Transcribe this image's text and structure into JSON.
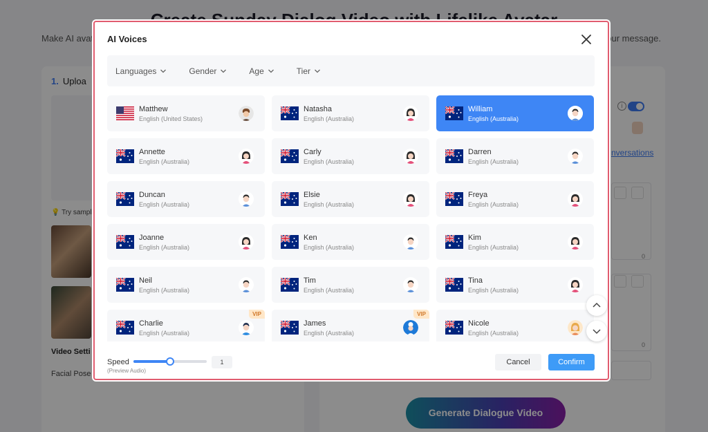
{
  "background": {
    "title": "Create Sunday Dialog Video with Lifelike Avatar",
    "subtitle": "Make AI avat",
    "subtitle_right": "our message.",
    "upload_num": "1.",
    "upload_label": "Uploa",
    "try_sample": "Try sample",
    "video_settings": "Video Setti",
    "facial_pose": "Facial Pose",
    "link": "nversations",
    "info": "i",
    "zero_1": "0",
    "zero_2": "0",
    "generate_button": "Generate Dialogue Video"
  },
  "modal": {
    "title": "AI Voices",
    "filters": [
      {
        "label": "Languages"
      },
      {
        "label": "Gender"
      },
      {
        "label": "Age"
      },
      {
        "label": "Tier"
      }
    ],
    "voices": [
      {
        "name": "Matthew",
        "lang": "English (United States)",
        "flag": "us",
        "avatar": "male-curly",
        "vip": false,
        "selected": false
      },
      {
        "name": "Natasha",
        "lang": "English (Australia)",
        "flag": "au",
        "avatar": "female",
        "vip": false,
        "selected": false
      },
      {
        "name": "William",
        "lang": "English (Australia)",
        "flag": "au",
        "avatar": "male",
        "vip": false,
        "selected": true
      },
      {
        "name": "Annette",
        "lang": "English (Australia)",
        "flag": "au",
        "avatar": "female",
        "vip": false,
        "selected": false
      },
      {
        "name": "Carly",
        "lang": "English (Australia)",
        "flag": "au",
        "avatar": "female",
        "vip": false,
        "selected": false
      },
      {
        "name": "Darren",
        "lang": "English (Australia)",
        "flag": "au",
        "avatar": "male",
        "vip": false,
        "selected": false
      },
      {
        "name": "Duncan",
        "lang": "English (Australia)",
        "flag": "au",
        "avatar": "male",
        "vip": false,
        "selected": false
      },
      {
        "name": "Elsie",
        "lang": "English (Australia)",
        "flag": "au",
        "avatar": "female",
        "vip": false,
        "selected": false
      },
      {
        "name": "Freya",
        "lang": "English (Australia)",
        "flag": "au",
        "avatar": "female",
        "vip": false,
        "selected": false
      },
      {
        "name": "Joanne",
        "lang": "English (Australia)",
        "flag": "au",
        "avatar": "female",
        "vip": false,
        "selected": false
      },
      {
        "name": "Ken",
        "lang": "English (Australia)",
        "flag": "au",
        "avatar": "male",
        "vip": false,
        "selected": false
      },
      {
        "name": "Kim",
        "lang": "English (Australia)",
        "flag": "au",
        "avatar": "female",
        "vip": false,
        "selected": false
      },
      {
        "name": "Neil",
        "lang": "English (Australia)",
        "flag": "au",
        "avatar": "male",
        "vip": false,
        "selected": false
      },
      {
        "name": "Tim",
        "lang": "English (Australia)",
        "flag": "au",
        "avatar": "male",
        "vip": false,
        "selected": false
      },
      {
        "name": "Tina",
        "lang": "English (Australia)",
        "flag": "au",
        "avatar": "female",
        "vip": false,
        "selected": false
      },
      {
        "name": "Charlie",
        "lang": "English (Australia)",
        "flag": "au",
        "avatar": "male-blue",
        "vip": true,
        "selected": false
      },
      {
        "name": "James",
        "lang": "English (Australia)",
        "flag": "au",
        "avatar": "chef",
        "vip": true,
        "selected": false
      },
      {
        "name": "Nicole",
        "lang": "English (Australia)",
        "flag": "au",
        "avatar": "female-blonde",
        "vip": false,
        "selected": false
      }
    ],
    "vip_label": "VIP",
    "speed": {
      "label": "Speed",
      "sublabel": "(Preview Audio)",
      "value": "1",
      "fraction": 0.5
    },
    "cancel_label": "Cancel",
    "confirm_label": "Confirm"
  },
  "colors": {
    "accent": "#3e86f5",
    "confirm": "#3e9bf7",
    "highlight_border": "#e15c6f",
    "vip_bg": "#ffe7c8",
    "vip_text": "#d0782a"
  }
}
